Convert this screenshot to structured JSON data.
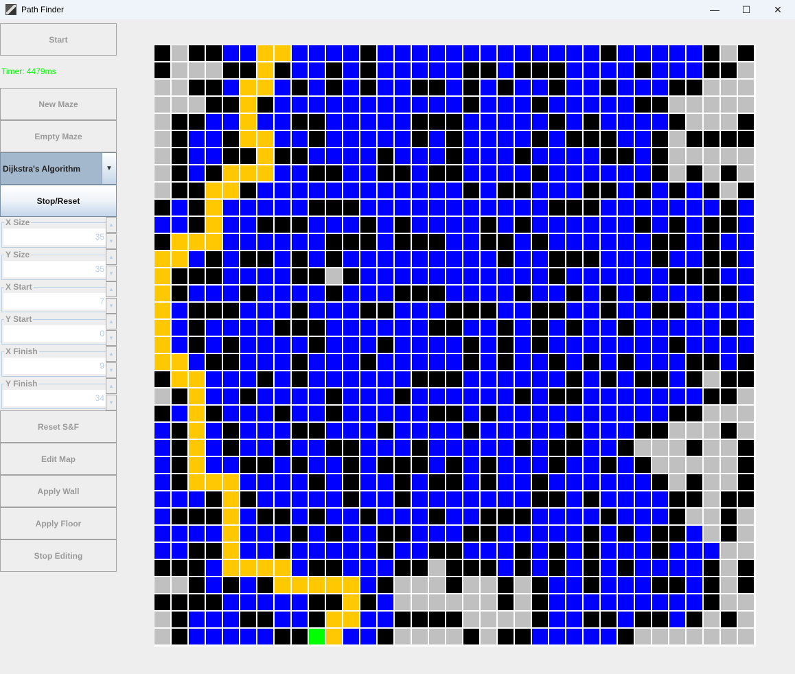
{
  "window": {
    "title": "Path Finder",
    "minimize": "—",
    "maximize": "☐",
    "close": "✕"
  },
  "controls": {
    "start_label": "Start",
    "timer": "Timer: 4479ms",
    "new_maze_label": "New Maze",
    "empty_maze_label": "Empty Maze",
    "algorithm_selected": "Dijkstra's Algorithm",
    "stop_reset_label": "Stop/Reset",
    "spinners": [
      {
        "label": "X Size",
        "value": "35"
      },
      {
        "label": "Y Size",
        "value": "35"
      },
      {
        "label": "X Start",
        "value": "7"
      },
      {
        "label": "Y Start",
        "value": "0"
      },
      {
        "label": "X Finish",
        "value": "9"
      },
      {
        "label": "Y Finish",
        "value": "34"
      }
    ],
    "reset_sf_label": "Reset S&F",
    "edit_map_label": "Edit Map",
    "apply_wall_label": "Apply Wall",
    "apply_floor_label": "Apply Floor",
    "stop_editing_label": "Stop Editing"
  },
  "maze": {
    "columns": 35,
    "rows_count": 35,
    "legend": {
      "K": {
        "meaning": "wall",
        "color": "#000000"
      },
      "G": {
        "meaning": "unvisited",
        "color": "#c0c0c0"
      },
      "U": {
        "meaning": "visited",
        "color": "#0000ff"
      },
      "Y": {
        "meaning": "path",
        "color": "#ffc800"
      },
      "F": {
        "meaning": "finish",
        "color": "#00ff00"
      }
    },
    "rows": [
      "KGKKUUYYUUUUKUUUUUUUUUUUUUKUUUUUKGK",
      "KGGGKKYKUUKUKUUUUUKKUKKKUUUUKUUUKKG",
      "GGKKUYYUKUKUKUUKKUKUKUUKUUKUUUKKGGG",
      "GGGKKYKUUUUUUUUUUUKUUUKUUUUUKKGGGGG",
      "GKKUUYUUKKUUUUUKKKUUUUUKUKUUUUKGGGK",
      "GKUUKYYUUKUUUUUKUKUUUUKUKKKUUKGKKKK",
      "GKUUKKYKKUUUUKUUUKUUUKUUUUKKUKGGGGG",
      "GKUKYYYUUKKUUKKUKKUUUUKUUUUUUKGKGKG",
      "GKKYYKUUUUUUUUUUUUKUKKUUUKKUKUKUKGK",
      "KUKYUUUUUKKKUUUUUUUUUUUKKKUUUUUUUKU",
      "UUKYUUKKKUUUKUKUUUUKUKUUUUUUKUKUKKU",
      "KYYYUUUUUUKKKUKKKUUKKUKUUUUUUKKUKUU",
      "YYUKUKKUKUKUUUUUUUUUKUUKKKUUUKUUKKU",
      "YKKKUUUUKKGKUUUUUUUUUUUKUUUUUUKKKUU",
      "YKUUUKUUUUKUUUKKKUUUUKUUKUKUKUUUKKU",
      "YUKKKUUUKUUUKKUUUKKKUUKKUUKUUKKUUUU",
      "YUKUUUUKKKUUUUUUKKUUKUKUKUUKUUUUUKU",
      "YUKUKUUUUKUUUKUUUUKUKUKUUUUUUUKUUUU",
      "YYUKKUUUKUUUKUUUUUKUKUUKUKUKUUUKKUK",
      "KYYUUUKUKUUUUUUKKKUUUUUUKUKUKKUKGKK",
      "GKYUUKUUUUKUUUKUUUUUUKUKKUUUUUUUKKG",
      "KUYKUUUKUUKUUUUUKKUKUUUUUUUUUUKKGGG",
      "UKYUKUUUKKUUUKUUUUKUUUUUKUUUKKGGGKG",
      "UKYUKUUKUUKKUUUKUUUUUKUKKUUKGGGKGGK",
      "UKYUUKKUKUUKUKKKUKUKUUUKUUKUKGGGGGK",
      "UKYYYUUUUKUKUUKUKKUKUUKUUUUUUKGKGGK",
      "UUUKYKUUUUUKUUKUUUUUUUKKUKUUUUKKGKK",
      "UKKKYUKKUKUUKUUUKUUKKKUUUUKUUUKGGKG",
      "UUUUYUUUKUKUUKKUUUKKUUUUUKUKUKKUGKG",
      "UUKKYUUKUUUUUKUUKKUUUKUKUKUUUKUUUGG",
      "KKKUYYYYUKKUUUKKGKKKUKUKUKUKUUUUKGK",
      "GGKUKUKYYYYYUKGGGKGGKGKUUKUUUKKUKGK",
      "KKKKUUUUUKKYKUGGGGGGKGKUUUUUUUUUKGG",
      "GKUUUKKUUKYYUUKKKKGGGGKUUKKUKKUKGKG",
      "GKUUUUUKKFYUUKGGGGKGKKUUUUUKGGGGGGG"
    ]
  }
}
